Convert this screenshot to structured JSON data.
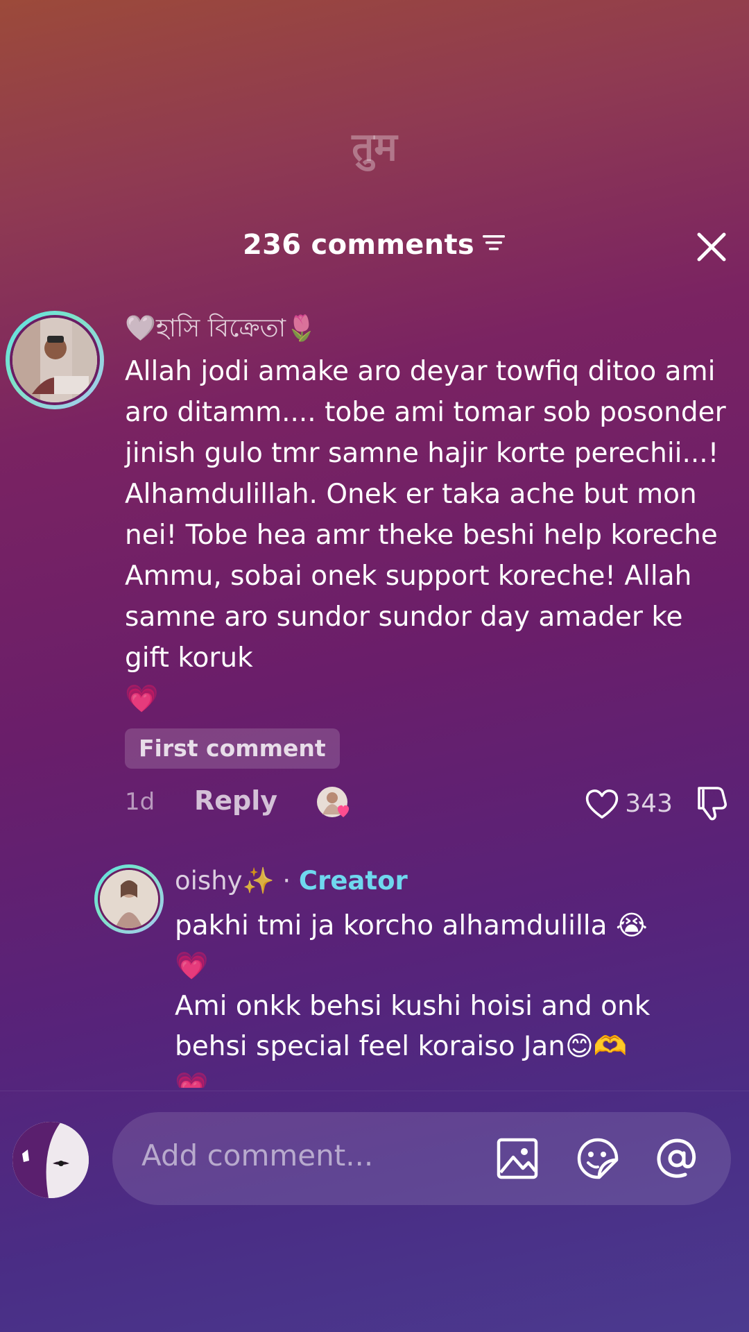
{
  "watermark": "तुम",
  "header": {
    "title": "236 comments"
  },
  "comments": [
    {
      "username": "🤍হাসি বিক্রেতা🌷",
      "text": "Allah jodi amake aro deyar towfiq ditoo ami aro ditamm.... tobe ami tomar sob posonder jinish gulo tmr samne hajir korte perechii...! Alhamdulillah. Onek er taka ache but mon nei! Tobe hea amr theke beshi help koreche Ammu, sobai onek support koreche! Allah samne aro sundor sundor day amader ke gift koruk",
      "trailing_emoji": "💗",
      "badge": "First comment",
      "time": "1d",
      "reply_label": "Reply",
      "likes": "343"
    }
  ],
  "reply": {
    "username": "oishy✨",
    "separator": " · ",
    "creator_tag": "Creator",
    "line1": "pakhi tmi ja korcho alhamdulilla 😭",
    "line2": "💗",
    "line3": "Ami onkk behsi kushi hoisi and onk behsi special feel koraiso Jan😊🫶",
    "line4": "💗"
  },
  "input": {
    "placeholder": "Add comment..."
  },
  "icons": {
    "filter": "filter-icon",
    "close": "close-icon",
    "like": "heart-outline-icon",
    "dislike": "thumb-down-icon",
    "image": "image-icon",
    "sticker": "sticker-icon",
    "mention": "at-sign-icon"
  },
  "colors": {
    "creator": "#6fd8ee",
    "avatar_ring": "#5de0e6"
  }
}
